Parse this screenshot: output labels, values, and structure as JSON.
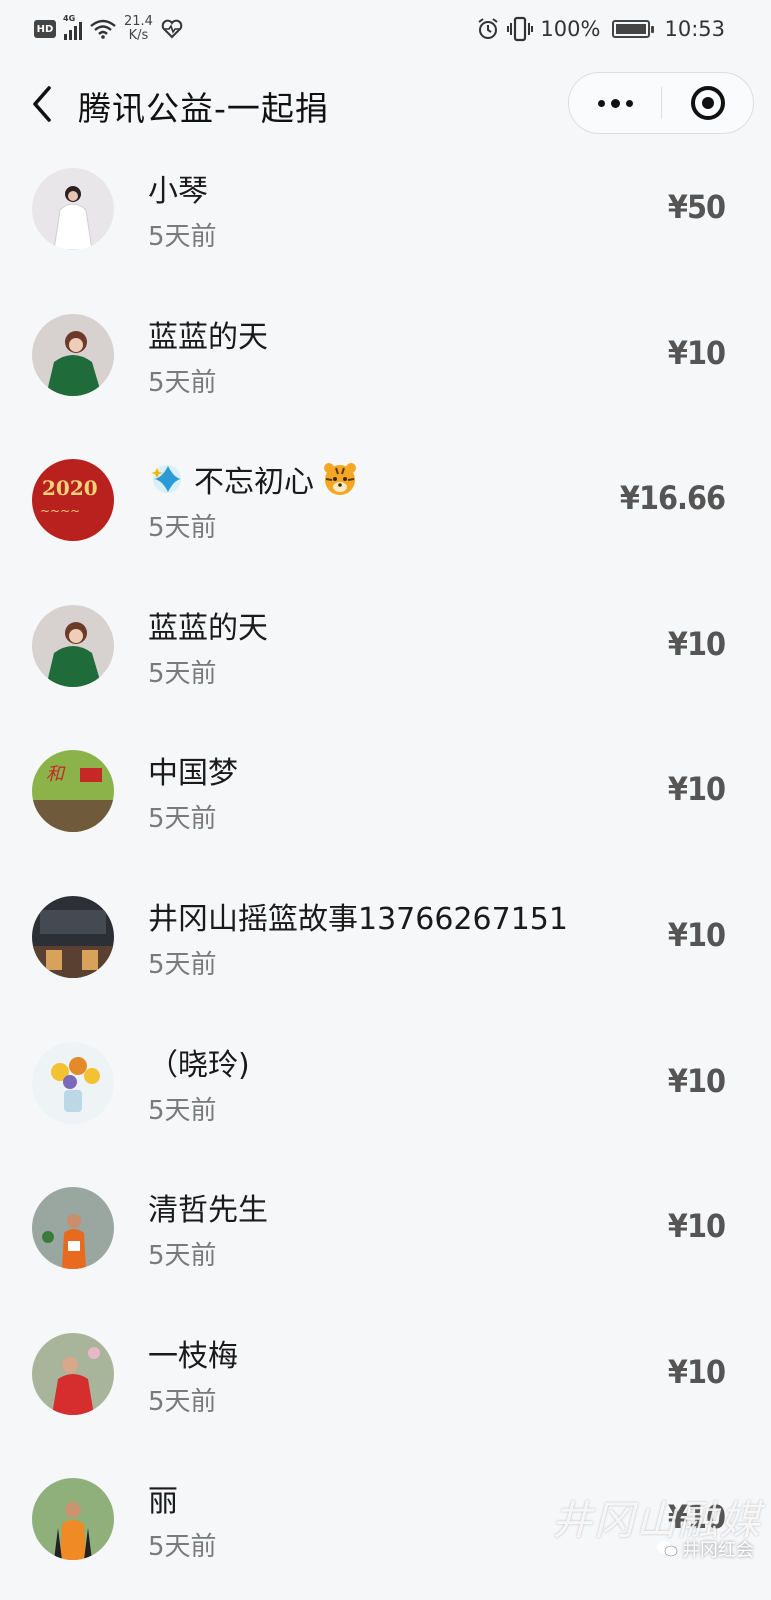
{
  "status_bar": {
    "hd": "HD",
    "network": "4G",
    "speed_value": "21.4",
    "speed_unit": "K/s",
    "battery": "100%",
    "time": "10:53"
  },
  "nav": {
    "title": "腾讯公益-一起捐"
  },
  "donors": [
    {
      "name": "小琴",
      "time": "5天前",
      "amount": "¥50"
    },
    {
      "name": "蓝蓝的天",
      "time": "5天前",
      "amount": "¥10"
    },
    {
      "name": "不忘初心",
      "time": "5天前",
      "amount": "¥16.66"
    },
    {
      "name": "蓝蓝的天",
      "time": "5天前",
      "amount": "¥10"
    },
    {
      "name": "中国梦",
      "time": "5天前",
      "amount": "¥10"
    },
    {
      "name": "井冈山摇篮故事13766267151",
      "time": "5天前",
      "amount": "¥10"
    },
    {
      "name": "（晓玲)",
      "time": "5天前",
      "amount": "¥10"
    },
    {
      "name": "清哲先生",
      "time": "5天前",
      "amount": "¥10"
    },
    {
      "name": "一枝梅",
      "time": "5天前",
      "amount": "¥10"
    },
    {
      "name": "丽",
      "time": "5天前",
      "amount": "¥10"
    }
  ],
  "watermark": {
    "brush": "井冈山融媒",
    "caption": "井冈红会"
  },
  "colors": {
    "background": "#f6f7f9",
    "text": "#1a1a1a",
    "muted": "#7a7a7a",
    "amount": "#555555"
  }
}
